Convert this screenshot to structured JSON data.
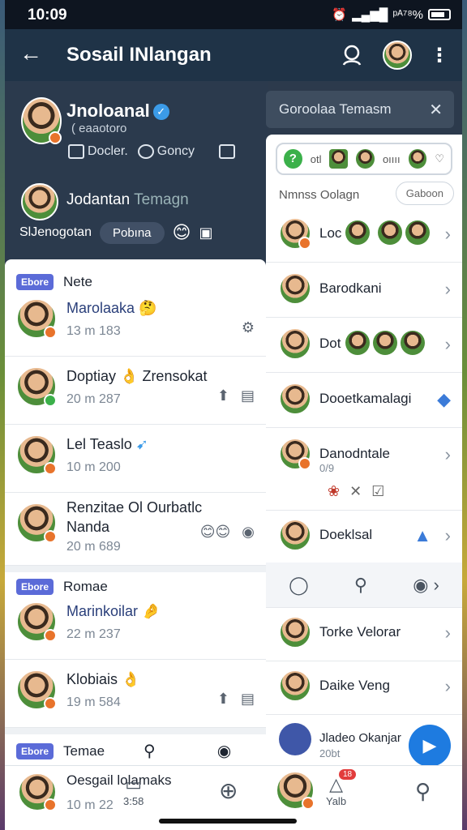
{
  "status": {
    "time": "10:09",
    "right_text": "ᵖᴬ⁷⁸%"
  },
  "appbar": {
    "title": "Sosail INlangan"
  },
  "profile": {
    "name": "Jnoloanal",
    "sub": "( eaaotoro",
    "tag1": "Docler.",
    "tag2": "Goncy",
    "second_name": "Jodantan",
    "second_name_muted": "Temagn",
    "subbar_label": "SlJenogotan",
    "subbar_pill": "Pobına"
  },
  "left_sections": [
    {
      "chip": "Ebore",
      "title": "Nete"
    },
    {
      "chip": "Ebore",
      "title": "Romae"
    },
    {
      "chip": "Ebore",
      "title": "Temae"
    }
  ],
  "left_items": [
    {
      "name": "Marolaaka 🤔",
      "meta": "13 m  183"
    },
    {
      "name": "Doptiay 👌 Zrensokat",
      "meta": "20 m  287"
    },
    {
      "name": "Lel Teaslo",
      "meta": "10 m  200"
    },
    {
      "name": "Renzitae Ol Ourbatlc",
      "name2": "Nanda",
      "meta": "20 m  689"
    },
    {
      "name": "Marinkoilar 🤌",
      "meta": "22 m  237"
    },
    {
      "name": "Klobiais 👌",
      "meta": "19 m  584"
    }
  ],
  "search": {
    "label": "Goroolaa Temasm"
  },
  "right": {
    "filter_text1": "otl",
    "filter_text2": "oıııı",
    "section_title": "Nmnss Oolagn",
    "section_btn": "Gaboon",
    "items": [
      {
        "name": "Loc",
        "sub": ""
      },
      {
        "name": "Barodkani",
        "sub": ""
      },
      {
        "name": "Dot",
        "sub": ""
      },
      {
        "name": "Dooetkamalagi",
        "sub": ""
      },
      {
        "name": "Danodntale",
        "sub": "0/9"
      },
      {
        "name": "Doeklsal",
        "sub": ""
      },
      {
        "name": "Torke Velorar",
        "sub": ""
      },
      {
        "name": "Daike Veng",
        "sub": ""
      },
      {
        "name": "Jladeo Okanjar",
        "sub": "20bt"
      }
    ]
  },
  "bottom": {
    "item_name": "Oesgail lolamaks",
    "item_meta": "10 m  22",
    "item_small": "3:58",
    "nav_badge": "18",
    "nav_label": "Yalb"
  }
}
